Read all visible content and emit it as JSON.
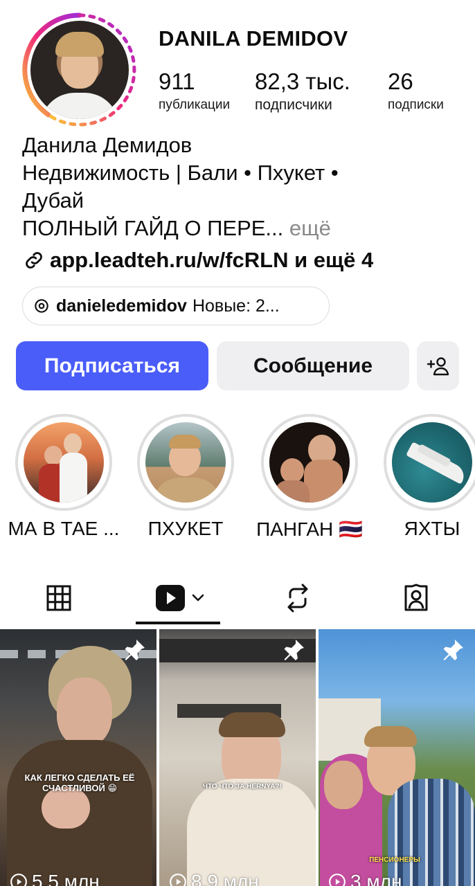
{
  "profile": {
    "username": "DANILA DEMIDOV",
    "stats": {
      "posts": {
        "value": "911",
        "label": "публикации"
      },
      "followers": {
        "value": "82,3 тыс.",
        "label": "подписчики"
      },
      "following": {
        "value": "26",
        "label": "подписки"
      }
    },
    "bio": {
      "name": "Данила Демидов",
      "line1": "Недвижимость | Бали • Пхукет •",
      "line2": "Дубай",
      "line3": "ПОЛНЫЙ ГАЙД О ПЕРЕ...",
      "more": " ещё"
    },
    "link": "app.leadteh.ru/w/fcRLN и ещё 4",
    "threads": {
      "handle": "danieledemidov",
      "suffix": "Новые: 2..."
    }
  },
  "buttons": {
    "follow": "Подписаться",
    "message": "Сообщение"
  },
  "highlights": [
    {
      "label": "МА В ТАЕ ..."
    },
    {
      "label": "ПХУКЕТ"
    },
    {
      "label": "ПАНГАН 🇹🇭"
    },
    {
      "label": "ЯХТЫ"
    }
  ],
  "posts": [
    {
      "overlay": "КАК ЛЕГКО СДЕЛАТЬ ЕЁ СЧАСТЛИВОЙ 😁",
      "views": "5,5 млн"
    },
    {
      "overlay": "ЧТО ЧТО ЗА HERNYA?!",
      "views": "8,9 млн"
    },
    {
      "overlay": "ПЕНСИОНЕРЫ",
      "views": "3 млн"
    }
  ],
  "colors": {
    "follow_button": "#4a5df9",
    "secondary_button": "#efeff1",
    "story_ring_start": "#f9ce34",
    "story_ring_end": "#ee2a7b"
  }
}
